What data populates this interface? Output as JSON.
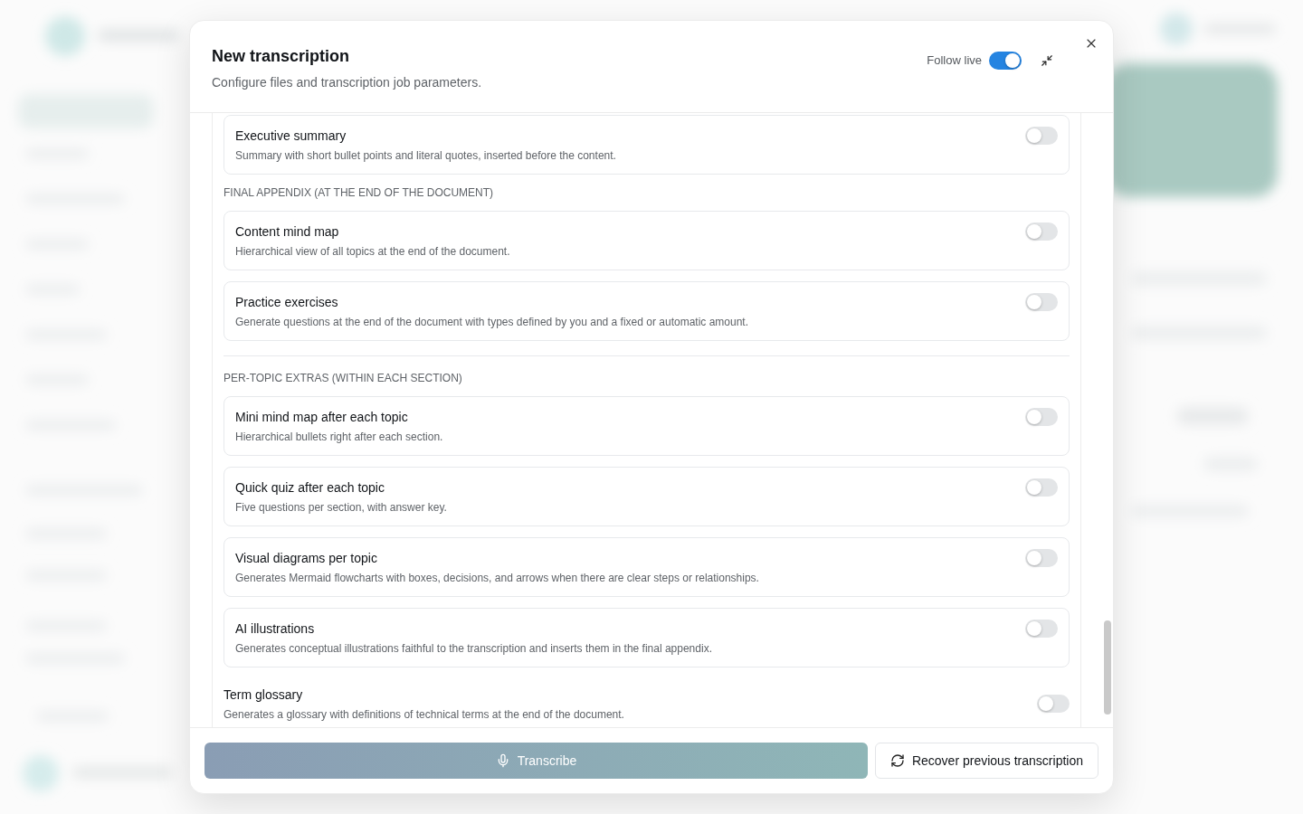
{
  "dialog": {
    "title": "New transcription",
    "subtitle": "Configure files and transcription job parameters.",
    "follow_live": {
      "label": "Follow live",
      "on": true
    },
    "sections": [
      {
        "divider_above": false,
        "options": [
          {
            "kind": "card",
            "title": "Executive summary",
            "description": "Summary with short bullet points and literal quotes, inserted before the content.",
            "on": false
          }
        ]
      },
      {
        "heading": "FINAL APPENDIX (AT THE END OF THE DOCUMENT)",
        "divider_above": false,
        "options": [
          {
            "kind": "card",
            "title": "Content mind map",
            "description": "Hierarchical view of all topics at the end of the document.",
            "on": false
          },
          {
            "kind": "card",
            "title": "Practice exercises",
            "description": "Generate questions at the end of the document with types defined by you and a fixed or automatic amount.",
            "on": false
          }
        ]
      },
      {
        "heading": "PER-TOPIC EXTRAS (WITHIN EACH SECTION)",
        "divider_above": true,
        "options": [
          {
            "kind": "card",
            "title": "Mini mind map after each topic",
            "description": "Hierarchical bullets right after each section.",
            "on": false
          },
          {
            "kind": "card",
            "title": "Quick quiz after each topic",
            "description": "Five questions per section, with answer key.",
            "on": false
          },
          {
            "kind": "card",
            "title": "Visual diagrams per topic",
            "description": "Generates Mermaid flowcharts with boxes, decisions, and arrows when there are clear steps or relationships.",
            "on": false
          },
          {
            "kind": "card",
            "title": "AI illustrations",
            "description": "Generates conceptual illustrations faithful to the transcription and inserts them in the final appendix.",
            "on": false
          },
          {
            "kind": "plain",
            "title": "Term glossary",
            "description": "Generates a glossary with definitions of technical terms at the end of the document.",
            "on": false
          }
        ]
      }
    ],
    "buttons": [
      {
        "kind": "primary",
        "label": "Transcribe"
      },
      {
        "kind": "secondary",
        "label": "Recover previous transcription"
      }
    ]
  }
}
